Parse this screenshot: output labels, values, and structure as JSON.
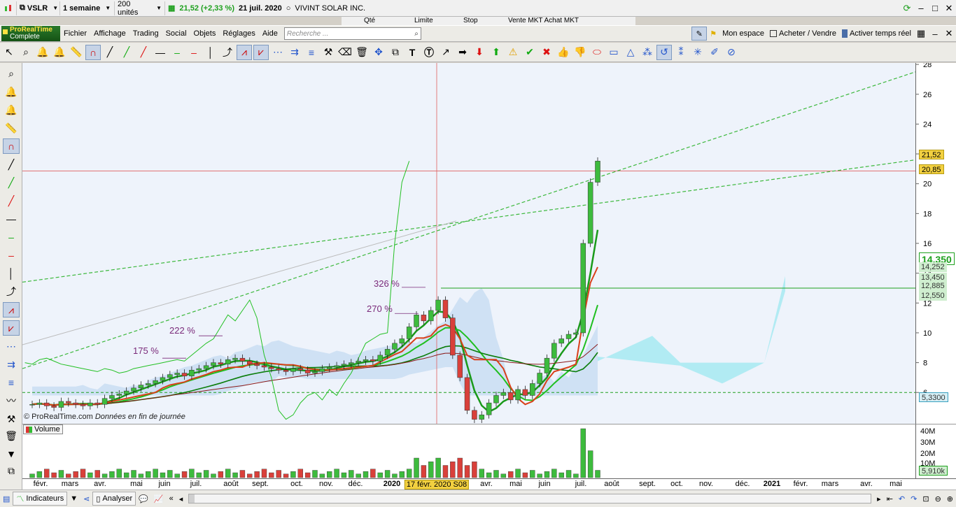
{
  "titlebar": {
    "symbol": "VSLR",
    "period": "1 semaine",
    "units": "200 unités",
    "last_price": "21,52 (+2,33 %)",
    "date": "21 juil. 2020",
    "company": "VIVINT SOLAR INC."
  },
  "orderbar": {
    "qty": "Qté",
    "limit": "Limite",
    "stop": "Stop",
    "sell_buy": "Vente MKT  Achat MKT"
  },
  "menubar": {
    "logo_line1": "ProRealTime",
    "logo_line2": "Complete",
    "items": [
      "Fichier",
      "Affichage",
      "Trading",
      "Social",
      "Objets",
      "Réglages",
      "Aide"
    ],
    "search_placeholder": "Recherche ...",
    "mon_espace": "Mon espace",
    "acheter_vendre": "Acheter / Vendre",
    "activer": "Activer temps réel"
  },
  "chart_data": {
    "type": "candlestick",
    "symbol": "VSLR",
    "y_ticks": [
      28,
      26,
      24,
      22,
      20,
      18,
      16,
      14,
      12,
      10,
      8,
      6
    ],
    "ylim": [
      3.9,
      28.1
    ],
    "right_labels": {
      "last": "21,52",
      "prev": "20,85",
      "big": "14,350",
      "sub1": "14,252",
      "l1": "13,450",
      "l2": "12,885",
      "l3": "12,550",
      "low": "5,3300"
    },
    "annotations": [
      "326 %",
      "270 %",
      "222 %",
      "175 %"
    ],
    "crosshair_date": "17 févr. 2020 S08",
    "x_labels": [
      "févr.",
      "mars",
      "avr.",
      "mai",
      "juin",
      "juil.",
      "août",
      "sept.",
      "oct.",
      "nov.",
      "déc.",
      "2020",
      "avr.",
      "mai",
      "juin",
      "juil.",
      "août",
      "sept.",
      "oct.",
      "nov.",
      "déc.",
      "2021",
      "févr.",
      "mars",
      "avr.",
      "mai"
    ],
    "candles_close": [
      5.2,
      5.3,
      5.1,
      5.0,
      5.4,
      5.3,
      5.2,
      5.1,
      5.3,
      5.2,
      5.6,
      5.8,
      5.9,
      6.1,
      6.3,
      6.5,
      6.6,
      6.8,
      7.0,
      7.2,
      7.3,
      7.1,
      7.5,
      7.6,
      7.8,
      8.0,
      7.9,
      8.2,
      8.3,
      8.1,
      7.9,
      7.8,
      7.7,
      7.6,
      7.5,
      7.4,
      7.6,
      7.5,
      7.3,
      7.4,
      7.6,
      7.7,
      7.8,
      7.9,
      8.0,
      8.1,
      8.2,
      8.1,
      8.5,
      8.9,
      9.3,
      9.6,
      10.4,
      11.2,
      10.8,
      11.5,
      12.2,
      11.0,
      8.5,
      7.0,
      4.8,
      4.2,
      4.5,
      5.3,
      5.8,
      6.0,
      5.5,
      6.2,
      5.8,
      6.6,
      7.3,
      8.3,
      9.3,
      9.6,
      9.9,
      10.0,
      16.0,
      20.1,
      21.52
    ],
    "volume_ticks": [
      "40M",
      "30M",
      "20M",
      "10M"
    ],
    "volume_last": "5,910k",
    "volume_label": "Volume"
  },
  "watermark": {
    "brand": "© ProRealTime.com",
    "note": "Données en fin de journée"
  },
  "bottombar": {
    "indicateurs": "Indicateurs",
    "analyser": "Analyser"
  },
  "colors": {
    "up": "#3dbb3d",
    "down": "#d9403a",
    "cloud": "#a8cdea",
    "accent_green": "#1ea01e"
  }
}
